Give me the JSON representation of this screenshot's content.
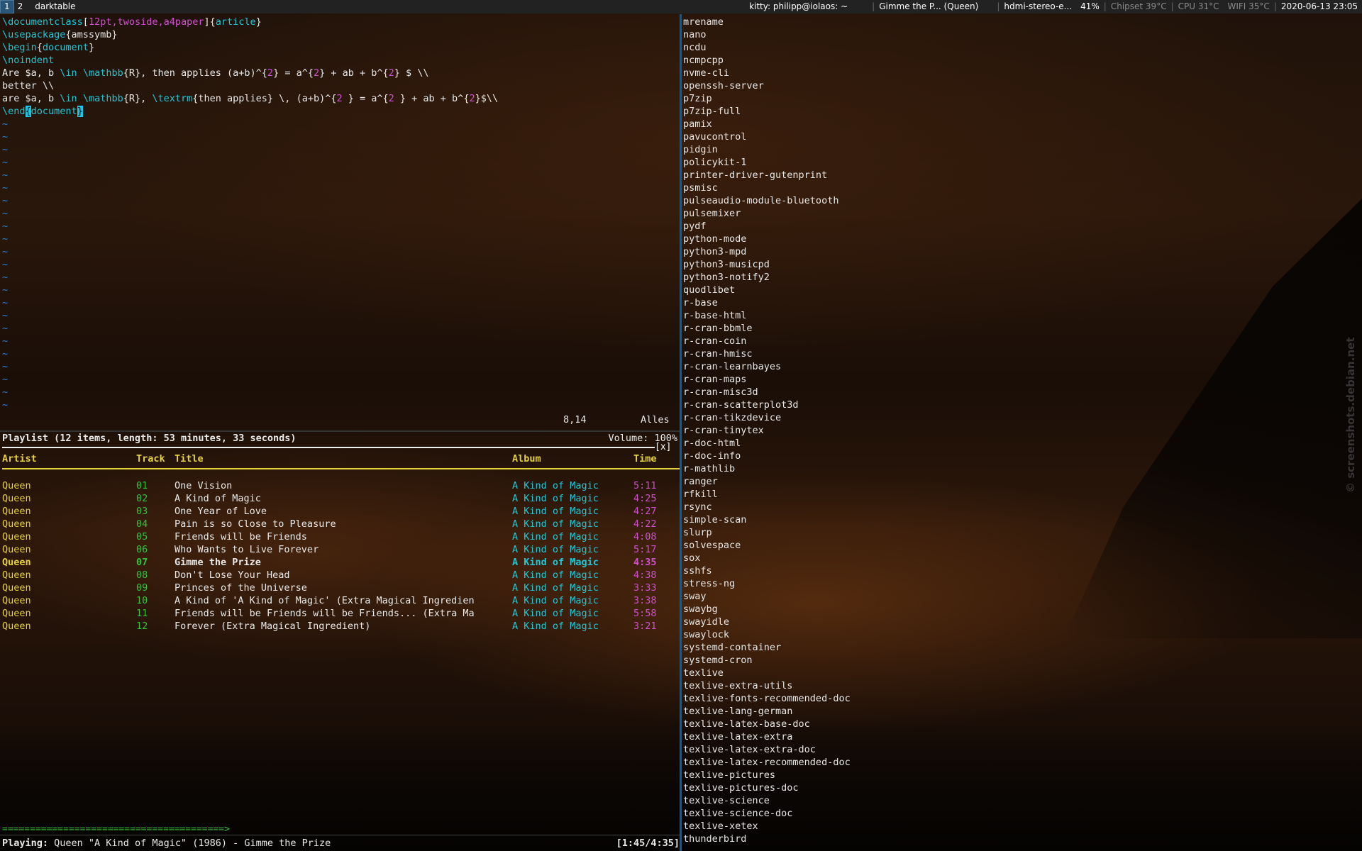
{
  "topbar": {
    "workspaces": [
      "1",
      "2"
    ],
    "app_title": "darktable",
    "window_title": "kitty: philipp@iolaos: ~",
    "media": "Gimme the P... (Queen)",
    "audio": "hdmi-stereo-e...",
    "volume": "41%",
    "chipset": "Chipset 39°C",
    "cpu": "CPU 31°C",
    "wifi": "WIFI 35°C",
    "datetime": "2020-06-13 23:05"
  },
  "vim": {
    "lines": [
      [
        {
          "t": "\\documentclass",
          "c": "kw"
        },
        {
          "t": "[",
          "c": ""
        },
        {
          "t": "12pt,twoside,a4paper",
          "c": "br"
        },
        {
          "t": "]{",
          "c": ""
        },
        {
          "t": "article",
          "c": "kw"
        },
        {
          "t": "}",
          "c": ""
        }
      ],
      [
        {
          "t": "\\usepackage",
          "c": "kw"
        },
        {
          "t": "{amssymb}",
          "c": ""
        }
      ],
      [
        {
          "t": "\\begin",
          "c": "kw"
        },
        {
          "t": "{",
          "c": ""
        },
        {
          "t": "document",
          "c": "kw"
        },
        {
          "t": "}",
          "c": ""
        }
      ],
      [
        {
          "t": "\\noindent",
          "c": "kw"
        }
      ],
      [
        {
          "t": "Are $a, b ",
          "c": ""
        },
        {
          "t": "\\in",
          "c": "kw"
        },
        {
          "t": " ",
          "c": ""
        },
        {
          "t": "\\mathbb",
          "c": "kw"
        },
        {
          "t": "{R}, then applies (a+b)^{",
          "c": ""
        },
        {
          "t": "2",
          "c": "br"
        },
        {
          "t": "} = a^{",
          "c": ""
        },
        {
          "t": "2",
          "c": "br"
        },
        {
          "t": "} + ab + b^{",
          "c": ""
        },
        {
          "t": "2",
          "c": "br"
        },
        {
          "t": "} $ \\\\",
          "c": ""
        }
      ],
      [
        {
          "t": "better \\\\",
          "c": ""
        }
      ],
      [
        {
          "t": "are $a, b ",
          "c": ""
        },
        {
          "t": "\\in",
          "c": "kw"
        },
        {
          "t": " ",
          "c": ""
        },
        {
          "t": "\\mathbb",
          "c": "kw"
        },
        {
          "t": "{R}, ",
          "c": ""
        },
        {
          "t": "\\textrm",
          "c": "kw"
        },
        {
          "t": "{then applies} \\, (a+b)^{",
          "c": ""
        },
        {
          "t": "2",
          "c": "br"
        },
        {
          "t": " } = a^{",
          "c": ""
        },
        {
          "t": "2",
          "c": "br"
        },
        {
          "t": " } + ab + b^{",
          "c": ""
        },
        {
          "t": "2",
          "c": "br"
        },
        {
          "t": "}$\\\\",
          "c": ""
        }
      ],
      [
        {
          "t": "\\end",
          "c": "kw"
        },
        {
          "t": "{",
          "c": "cursor"
        },
        {
          "t": "document",
          "c": "kw"
        },
        {
          "t": "}",
          "c": "cursor"
        }
      ]
    ],
    "tilde_count": 23,
    "position": "8,14",
    "scroll": "Alles"
  },
  "ncmpcpp": {
    "header": "Playlist (12 items, length: 53 minutes, 33 seconds)",
    "volume": "Volume: 100%",
    "close": "[x]",
    "columns": {
      "artist": "Artist",
      "track": "Track",
      "title": "Title",
      "album": "Album",
      "time": "Time"
    },
    "rows": [
      {
        "artist": "Queen",
        "track": "01",
        "title": "One Vision",
        "album": "A Kind of Magic",
        "time": "5:11",
        "playing": false
      },
      {
        "artist": "Queen",
        "track": "02",
        "title": "A Kind of Magic",
        "album": "A Kind of Magic",
        "time": "4:25",
        "playing": false
      },
      {
        "artist": "Queen",
        "track": "03",
        "title": "One Year of Love",
        "album": "A Kind of Magic",
        "time": "4:27",
        "playing": false
      },
      {
        "artist": "Queen",
        "track": "04",
        "title": "Pain is so Close to Pleasure",
        "album": "A Kind of Magic",
        "time": "4:22",
        "playing": false
      },
      {
        "artist": "Queen",
        "track": "05",
        "title": "Friends will be Friends",
        "album": "A Kind of Magic",
        "time": "4:08",
        "playing": false
      },
      {
        "artist": "Queen",
        "track": "06",
        "title": "Who Wants to Live Forever",
        "album": "A Kind of Magic",
        "time": "5:17",
        "playing": false
      },
      {
        "artist": "Queen",
        "track": "07",
        "title": "Gimme the Prize",
        "album": "A Kind of Magic",
        "time": "4:35",
        "playing": true
      },
      {
        "artist": "Queen",
        "track": "08",
        "title": "Don't Lose Your Head",
        "album": "A Kind of Magic",
        "time": "4:38",
        "playing": false
      },
      {
        "artist": "Queen",
        "track": "09",
        "title": "Princes of the Universe",
        "album": "A Kind of Magic",
        "time": "3:33",
        "playing": false
      },
      {
        "artist": "Queen",
        "track": "10",
        "title": "A Kind of 'A Kind of Magic' (Extra Magical Ingredien",
        "album": "A Kind of Magic",
        "time": "3:38",
        "playing": false
      },
      {
        "artist": "Queen",
        "track": "11",
        "title": "Friends will be Friends will be Friends... (Extra Ma",
        "album": "A Kind of Magic",
        "time": "5:58",
        "playing": false
      },
      {
        "artist": "Queen",
        "track": "12",
        "title": "Forever (Extra Magical Ingredient)",
        "album": "A Kind of Magic",
        "time": "3:21",
        "playing": false
      }
    ],
    "progress_bar": "========================================>",
    "progress_fraction": 0.38,
    "playing_label": "Playing:",
    "playing_text": " Queen \"A Kind of Magic\" (1986) - Gimme the Prize",
    "elapsed": "[1:45/4:35]"
  },
  "packages": [
    "mrename",
    "nano",
    "ncdu",
    "ncmpcpp",
    "nvme-cli",
    "openssh-server",
    "p7zip",
    "p7zip-full",
    "pamix",
    "pavucontrol",
    "pidgin",
    "policykit-1",
    "printer-driver-gutenprint",
    "psmisc",
    "pulseaudio-module-bluetooth",
    "pulsemixer",
    "pydf",
    "python-mode",
    "python3-mpd",
    "python3-musicpd",
    "python3-notify2",
    "quodlibet",
    "r-base",
    "r-base-html",
    "r-cran-bbmle",
    "r-cran-coin",
    "r-cran-hmisc",
    "r-cran-learnbayes",
    "r-cran-maps",
    "r-cran-misc3d",
    "r-cran-scatterplot3d",
    "r-cran-tikzdevice",
    "r-cran-tinytex",
    "r-doc-html",
    "r-doc-info",
    "r-mathlib",
    "ranger",
    "rfkill",
    "rsync",
    "simple-scan",
    "slurp",
    "solvespace",
    "sox",
    "sshfs",
    "stress-ng",
    "sway",
    "swaybg",
    "swayidle",
    "swaylock",
    "systemd-container",
    "systemd-cron",
    "texlive",
    "texlive-extra-utils",
    "texlive-fonts-recommended-doc",
    "texlive-lang-german",
    "texlive-latex-base-doc",
    "texlive-latex-extra",
    "texlive-latex-extra-doc",
    "texlive-latex-recommended-doc",
    "texlive-pictures",
    "texlive-pictures-doc",
    "texlive-science",
    "texlive-science-doc",
    "texlive-xetex",
    "thunderbird"
  ],
  "watermark": "© screenshots.debian.net"
}
